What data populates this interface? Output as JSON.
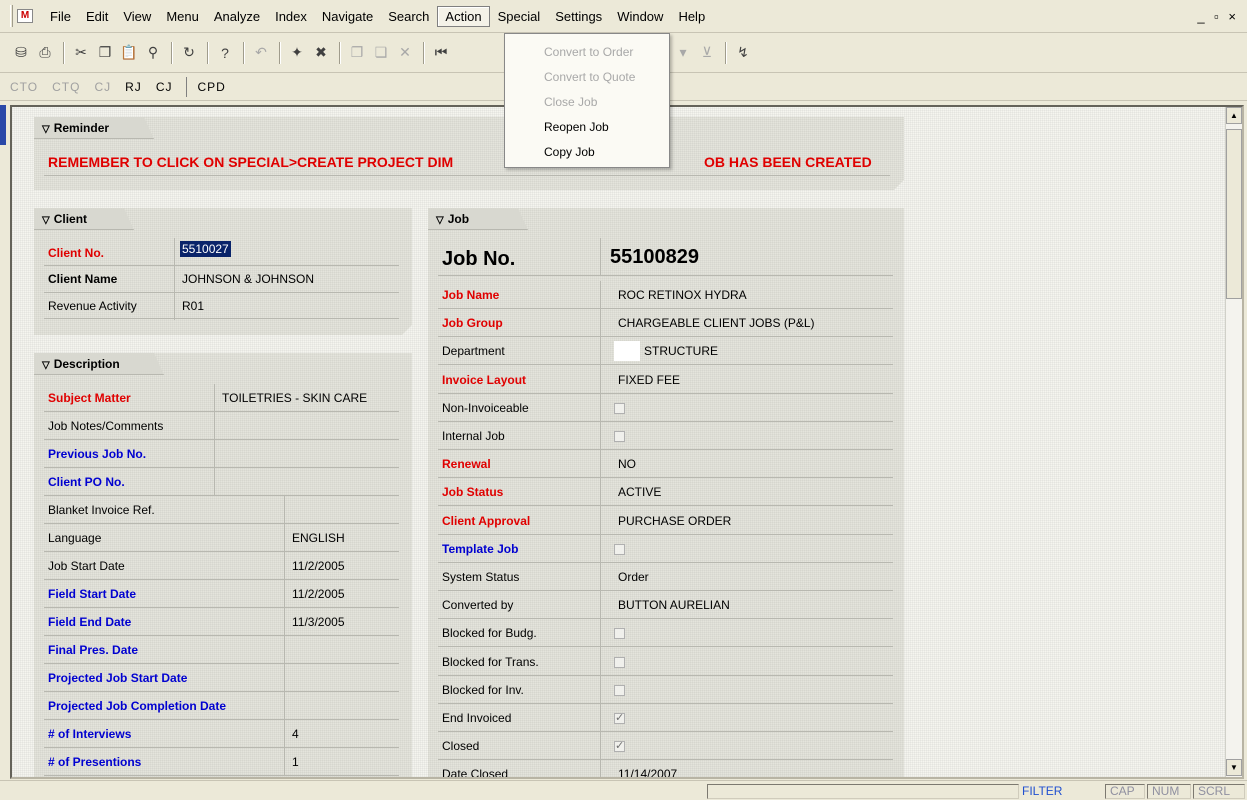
{
  "menu": {
    "items": [
      "File",
      "Edit",
      "View",
      "Menu",
      "Analyze",
      "Index",
      "Navigate",
      "Search",
      "Action",
      "Special",
      "Settings",
      "Window",
      "Help"
    ],
    "active": "Action",
    "window_controls": "_ ▫ ×"
  },
  "action_menu": [
    {
      "label": "Convert to Order",
      "enabled": false
    },
    {
      "label": "Convert to Quote",
      "enabled": false
    },
    {
      "label": "Close Job",
      "enabled": false
    },
    {
      "label": "Reopen Job",
      "enabled": true
    },
    {
      "label": "Copy Job",
      "enabled": true
    }
  ],
  "shortcuts": {
    "dim": [
      "CTO",
      "CTQ",
      "CJ"
    ],
    "active": [
      "RJ",
      "CJ",
      "CPD"
    ]
  },
  "reminder": {
    "header": "Reminder",
    "text_left": "REMEMBER TO CLICK ON SPECIAL>CREATE PROJECT DIM",
    "text_right": "OB HAS BEEN CREATED",
    "color": "#e00000"
  },
  "client": {
    "header": "Client",
    "fields": [
      {
        "label": "Client No.",
        "value": "5510027"
      },
      {
        "label": "Client Name",
        "value": "JOHNSON & JOHNSON"
      },
      {
        "label": "Revenue Activity",
        "value": "R01"
      }
    ]
  },
  "description": {
    "header": "Description",
    "fields": [
      {
        "label": "Subject Matter",
        "value": "TOILETRIES - SKIN CARE"
      },
      {
        "label": "Job Notes/Comments",
        "value": ""
      },
      {
        "label": "Previous Job No.",
        "value": ""
      },
      {
        "label": "Client PO No.",
        "value": ""
      },
      {
        "label": "Blanket Invoice Ref.",
        "value": ""
      },
      {
        "label": "Language",
        "value": "ENGLISH"
      },
      {
        "label": "Job Start Date",
        "value": "11/2/2005"
      },
      {
        "label": "Field Start Date",
        "value": "11/2/2005"
      },
      {
        "label": "Field End Date",
        "value": "11/3/2005"
      },
      {
        "label": "Final Pres. Date",
        "value": ""
      },
      {
        "label": "Projected Job Start Date",
        "value": ""
      },
      {
        "label": "Projected Job Completion Date",
        "value": ""
      },
      {
        "label": "# of Interviews",
        "value": "4"
      },
      {
        "label": "# of Presentions",
        "value": "1"
      }
    ]
  },
  "job": {
    "header": "Job",
    "title_label": "Job No.",
    "title_value": "55100829",
    "fields": [
      {
        "label": "Job Name",
        "value": "ROC RETINOX HYDRA"
      },
      {
        "label": "Job Group",
        "value": "CHARGEABLE CLIENT JOBS (P&L)"
      },
      {
        "label": "Department",
        "value": "STRUCTURE"
      },
      {
        "label": "Invoice Layout",
        "value": "FIXED FEE"
      },
      {
        "label": "Non-Invoiceable",
        "value": ""
      },
      {
        "label": "Internal Job",
        "value": ""
      },
      {
        "label": "Renewal",
        "value": "NO"
      },
      {
        "label": "Job Status",
        "value": "ACTIVE"
      },
      {
        "label": "Client Approval",
        "value": "PURCHASE ORDER"
      },
      {
        "label": "Template Job",
        "value": ""
      },
      {
        "label": "System Status",
        "value": "Order"
      },
      {
        "label": "Converted by",
        "value": "BUTTON AURELIAN"
      },
      {
        "label": "Blocked for Budg.",
        "value": ""
      },
      {
        "label": "Blocked for Trans.",
        "value": ""
      },
      {
        "label": "Blocked for Inv.",
        "value": ""
      },
      {
        "label": "End Invoiced",
        "value": ""
      },
      {
        "label": "Closed",
        "value": ""
      },
      {
        "label": "Date Closed",
        "value": "11/14/2007"
      }
    ]
  },
  "status": {
    "items": [
      "FILTER",
      "CAP",
      "NUM",
      "SCRL"
    ]
  },
  "colors": {
    "required": "#e00000",
    "link": "#0000d0",
    "selection": "#0a246a"
  }
}
